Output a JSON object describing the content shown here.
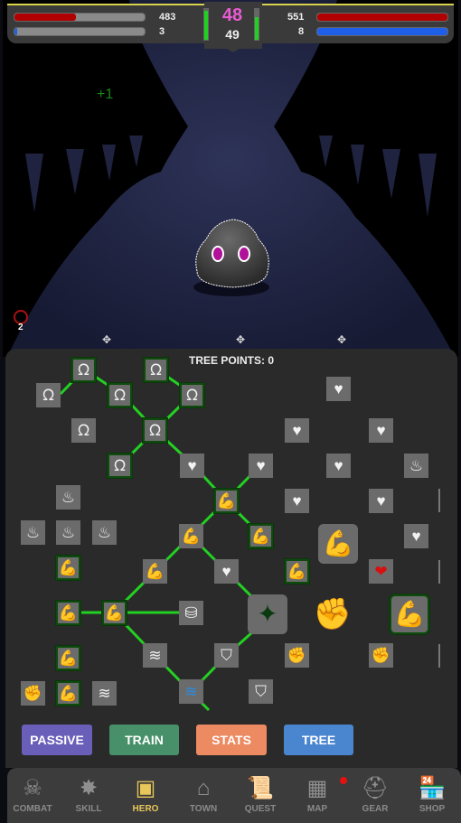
{
  "hud": {
    "player_hp": 483,
    "player_hp_fraction": 0.47,
    "player_mp": 3,
    "player_mp_fraction": 0.01,
    "level_current": "48",
    "level_next": "49",
    "enemy_hp": 551,
    "enemy_hp_fraction": 1.0,
    "enemy_mp": 8,
    "enemy_mp_fraction": 1.0,
    "left_gauge_fraction": 0.95,
    "right_gauge_fraction": 0.75,
    "colors": {
      "hp": "#b00000",
      "mp": "#1e5ee8",
      "level": "#e85ad2",
      "gauge": "#1fd21f"
    }
  },
  "scene": {
    "floating_text": "+1",
    "buff_count": "2",
    "enemy": "dark fuzzy blob with magenta eyes"
  },
  "tree": {
    "points_label": "TREE POINTS: 0",
    "line_color": "#22d122",
    "nodes": [
      {
        "icon": "claw-icon",
        "active": true
      },
      {
        "icon": "claw-icon",
        "active": true
      },
      {
        "icon": "claw-icon",
        "active": false
      },
      {
        "icon": "claw-icon",
        "active": true
      },
      {
        "icon": "claw-icon",
        "active": true
      },
      {
        "icon": "claw-icon",
        "active": true
      },
      {
        "icon": "claw-icon",
        "active": false
      },
      {
        "icon": "claw-icon",
        "active": true
      },
      {
        "icon": "heart-icon",
        "active": false
      },
      {
        "icon": "heart-icon",
        "active": false
      },
      {
        "icon": "heart-icon",
        "active": false
      },
      {
        "icon": "heart-icon",
        "active": false
      },
      {
        "icon": "heart-icon",
        "active": false
      },
      {
        "icon": "heart-icon",
        "active": false
      },
      {
        "icon": "fire-icon",
        "active": false
      },
      {
        "icon": "fire-icon",
        "active": false
      },
      {
        "icon": "fire-icon",
        "active": false
      },
      {
        "icon": "fire-icon",
        "active": false
      },
      {
        "icon": "fire-icon",
        "active": false
      },
      {
        "icon": "muscle-icon",
        "active": true
      },
      {
        "icon": "muscle-icon",
        "active": true
      },
      {
        "icon": "muscle-icon",
        "active": false
      },
      {
        "icon": "muscle-icon",
        "active": false
      },
      {
        "icon": "muscle-icon",
        "active": true
      },
      {
        "icon": "heart-icon",
        "active": false
      },
      {
        "icon": "heart-icon",
        "active": false
      },
      {
        "icon": "heart-icon",
        "active": false
      },
      {
        "icon": "heart-icon",
        "active": false
      },
      {
        "icon": "big-heart-icon",
        "active": false
      },
      {
        "icon": "muscle-icon",
        "active": false
      },
      {
        "icon": "muscle-icon",
        "active": true
      },
      {
        "icon": "muscle-icon",
        "active": true
      },
      {
        "icon": "big-muscle-icon",
        "active": true
      },
      {
        "icon": "skill-tree-icon",
        "active": false
      },
      {
        "icon": "big-shield-icon",
        "active": false
      },
      {
        "icon": "fist-icon",
        "active": false
      },
      {
        "icon": "muscle-icon",
        "active": true
      },
      {
        "icon": "muscle-icon",
        "active": true
      },
      {
        "icon": "wave-icon",
        "active": false
      },
      {
        "icon": "shield-icon",
        "active": false
      },
      {
        "icon": "fist-icon",
        "active": false
      },
      {
        "icon": "fist-icon",
        "active": false
      },
      {
        "icon": "fist-icon",
        "active": false
      },
      {
        "icon": "muscle-icon",
        "active": true
      },
      {
        "icon": "wave-icon",
        "active": false
      },
      {
        "icon": "big-wave-icon",
        "active": false
      },
      {
        "icon": "shield-icon",
        "active": false
      }
    ]
  },
  "buttons": [
    {
      "label": "PASSIVE",
      "color": "#6a5fb8"
    },
    {
      "label": "TRAIN",
      "color": "#47906a"
    },
    {
      "label": "STATS",
      "color": "#ec8a62"
    },
    {
      "label": "TREE",
      "color": "#4a85d0"
    }
  ],
  "nav": {
    "items": [
      {
        "label": "COMBAT",
        "icon": "skull-swords-icon"
      },
      {
        "label": "SKILL",
        "icon": "fist-burst-icon"
      },
      {
        "label": "HERO",
        "icon": "hero-card-icon",
        "active": true
      },
      {
        "label": "TOWN",
        "icon": "town-icon"
      },
      {
        "label": "QUEST",
        "icon": "scroll-icon"
      },
      {
        "label": "MAP",
        "icon": "map-icon",
        "notification": true
      },
      {
        "label": "GEAR",
        "icon": "helmet-icon"
      },
      {
        "label": "SHOP",
        "icon": "shop-icon"
      }
    ]
  }
}
